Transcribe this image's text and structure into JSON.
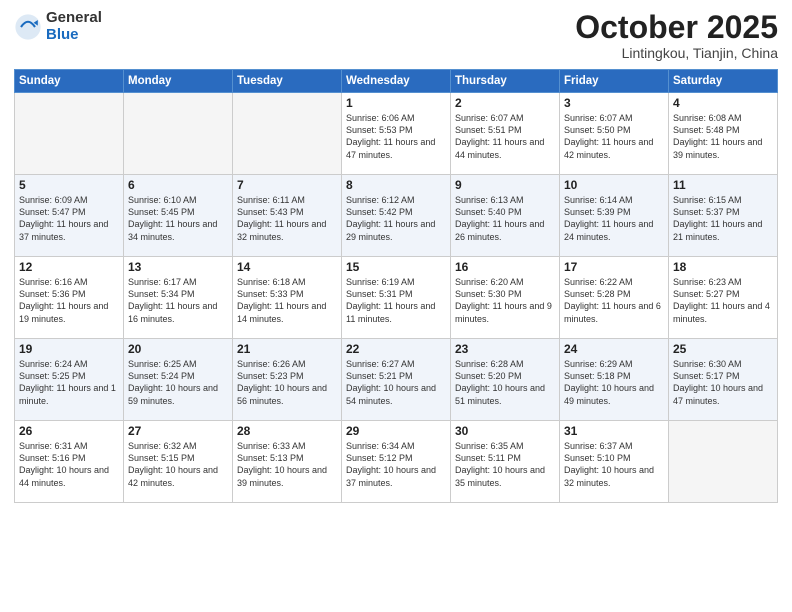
{
  "header": {
    "logo_general": "General",
    "logo_blue": "Blue",
    "month": "October 2025",
    "location": "Lintingkou, Tianjin, China"
  },
  "days_of_week": [
    "Sunday",
    "Monday",
    "Tuesday",
    "Wednesday",
    "Thursday",
    "Friday",
    "Saturday"
  ],
  "weeks": [
    [
      {
        "day": "",
        "text": ""
      },
      {
        "day": "",
        "text": ""
      },
      {
        "day": "",
        "text": ""
      },
      {
        "day": "1",
        "text": "Sunrise: 6:06 AM\nSunset: 5:53 PM\nDaylight: 11 hours and 47 minutes."
      },
      {
        "day": "2",
        "text": "Sunrise: 6:07 AM\nSunset: 5:51 PM\nDaylight: 11 hours and 44 minutes."
      },
      {
        "day": "3",
        "text": "Sunrise: 6:07 AM\nSunset: 5:50 PM\nDaylight: 11 hours and 42 minutes."
      },
      {
        "day": "4",
        "text": "Sunrise: 6:08 AM\nSunset: 5:48 PM\nDaylight: 11 hours and 39 minutes."
      }
    ],
    [
      {
        "day": "5",
        "text": "Sunrise: 6:09 AM\nSunset: 5:47 PM\nDaylight: 11 hours and 37 minutes."
      },
      {
        "day": "6",
        "text": "Sunrise: 6:10 AM\nSunset: 5:45 PM\nDaylight: 11 hours and 34 minutes."
      },
      {
        "day": "7",
        "text": "Sunrise: 6:11 AM\nSunset: 5:43 PM\nDaylight: 11 hours and 32 minutes."
      },
      {
        "day": "8",
        "text": "Sunrise: 6:12 AM\nSunset: 5:42 PM\nDaylight: 11 hours and 29 minutes."
      },
      {
        "day": "9",
        "text": "Sunrise: 6:13 AM\nSunset: 5:40 PM\nDaylight: 11 hours and 26 minutes."
      },
      {
        "day": "10",
        "text": "Sunrise: 6:14 AM\nSunset: 5:39 PM\nDaylight: 11 hours and 24 minutes."
      },
      {
        "day": "11",
        "text": "Sunrise: 6:15 AM\nSunset: 5:37 PM\nDaylight: 11 hours and 21 minutes."
      }
    ],
    [
      {
        "day": "12",
        "text": "Sunrise: 6:16 AM\nSunset: 5:36 PM\nDaylight: 11 hours and 19 minutes."
      },
      {
        "day": "13",
        "text": "Sunrise: 6:17 AM\nSunset: 5:34 PM\nDaylight: 11 hours and 16 minutes."
      },
      {
        "day": "14",
        "text": "Sunrise: 6:18 AM\nSunset: 5:33 PM\nDaylight: 11 hours and 14 minutes."
      },
      {
        "day": "15",
        "text": "Sunrise: 6:19 AM\nSunset: 5:31 PM\nDaylight: 11 hours and 11 minutes."
      },
      {
        "day": "16",
        "text": "Sunrise: 6:20 AM\nSunset: 5:30 PM\nDaylight: 11 hours and 9 minutes."
      },
      {
        "day": "17",
        "text": "Sunrise: 6:22 AM\nSunset: 5:28 PM\nDaylight: 11 hours and 6 minutes."
      },
      {
        "day": "18",
        "text": "Sunrise: 6:23 AM\nSunset: 5:27 PM\nDaylight: 11 hours and 4 minutes."
      }
    ],
    [
      {
        "day": "19",
        "text": "Sunrise: 6:24 AM\nSunset: 5:25 PM\nDaylight: 11 hours and 1 minute."
      },
      {
        "day": "20",
        "text": "Sunrise: 6:25 AM\nSunset: 5:24 PM\nDaylight: 10 hours and 59 minutes."
      },
      {
        "day": "21",
        "text": "Sunrise: 6:26 AM\nSunset: 5:23 PM\nDaylight: 10 hours and 56 minutes."
      },
      {
        "day": "22",
        "text": "Sunrise: 6:27 AM\nSunset: 5:21 PM\nDaylight: 10 hours and 54 minutes."
      },
      {
        "day": "23",
        "text": "Sunrise: 6:28 AM\nSunset: 5:20 PM\nDaylight: 10 hours and 51 minutes."
      },
      {
        "day": "24",
        "text": "Sunrise: 6:29 AM\nSunset: 5:18 PM\nDaylight: 10 hours and 49 minutes."
      },
      {
        "day": "25",
        "text": "Sunrise: 6:30 AM\nSunset: 5:17 PM\nDaylight: 10 hours and 47 minutes."
      }
    ],
    [
      {
        "day": "26",
        "text": "Sunrise: 6:31 AM\nSunset: 5:16 PM\nDaylight: 10 hours and 44 minutes."
      },
      {
        "day": "27",
        "text": "Sunrise: 6:32 AM\nSunset: 5:15 PM\nDaylight: 10 hours and 42 minutes."
      },
      {
        "day": "28",
        "text": "Sunrise: 6:33 AM\nSunset: 5:13 PM\nDaylight: 10 hours and 39 minutes."
      },
      {
        "day": "29",
        "text": "Sunrise: 6:34 AM\nSunset: 5:12 PM\nDaylight: 10 hours and 37 minutes."
      },
      {
        "day": "30",
        "text": "Sunrise: 6:35 AM\nSunset: 5:11 PM\nDaylight: 10 hours and 35 minutes."
      },
      {
        "day": "31",
        "text": "Sunrise: 6:37 AM\nSunset: 5:10 PM\nDaylight: 10 hours and 32 minutes."
      },
      {
        "day": "",
        "text": ""
      }
    ]
  ]
}
